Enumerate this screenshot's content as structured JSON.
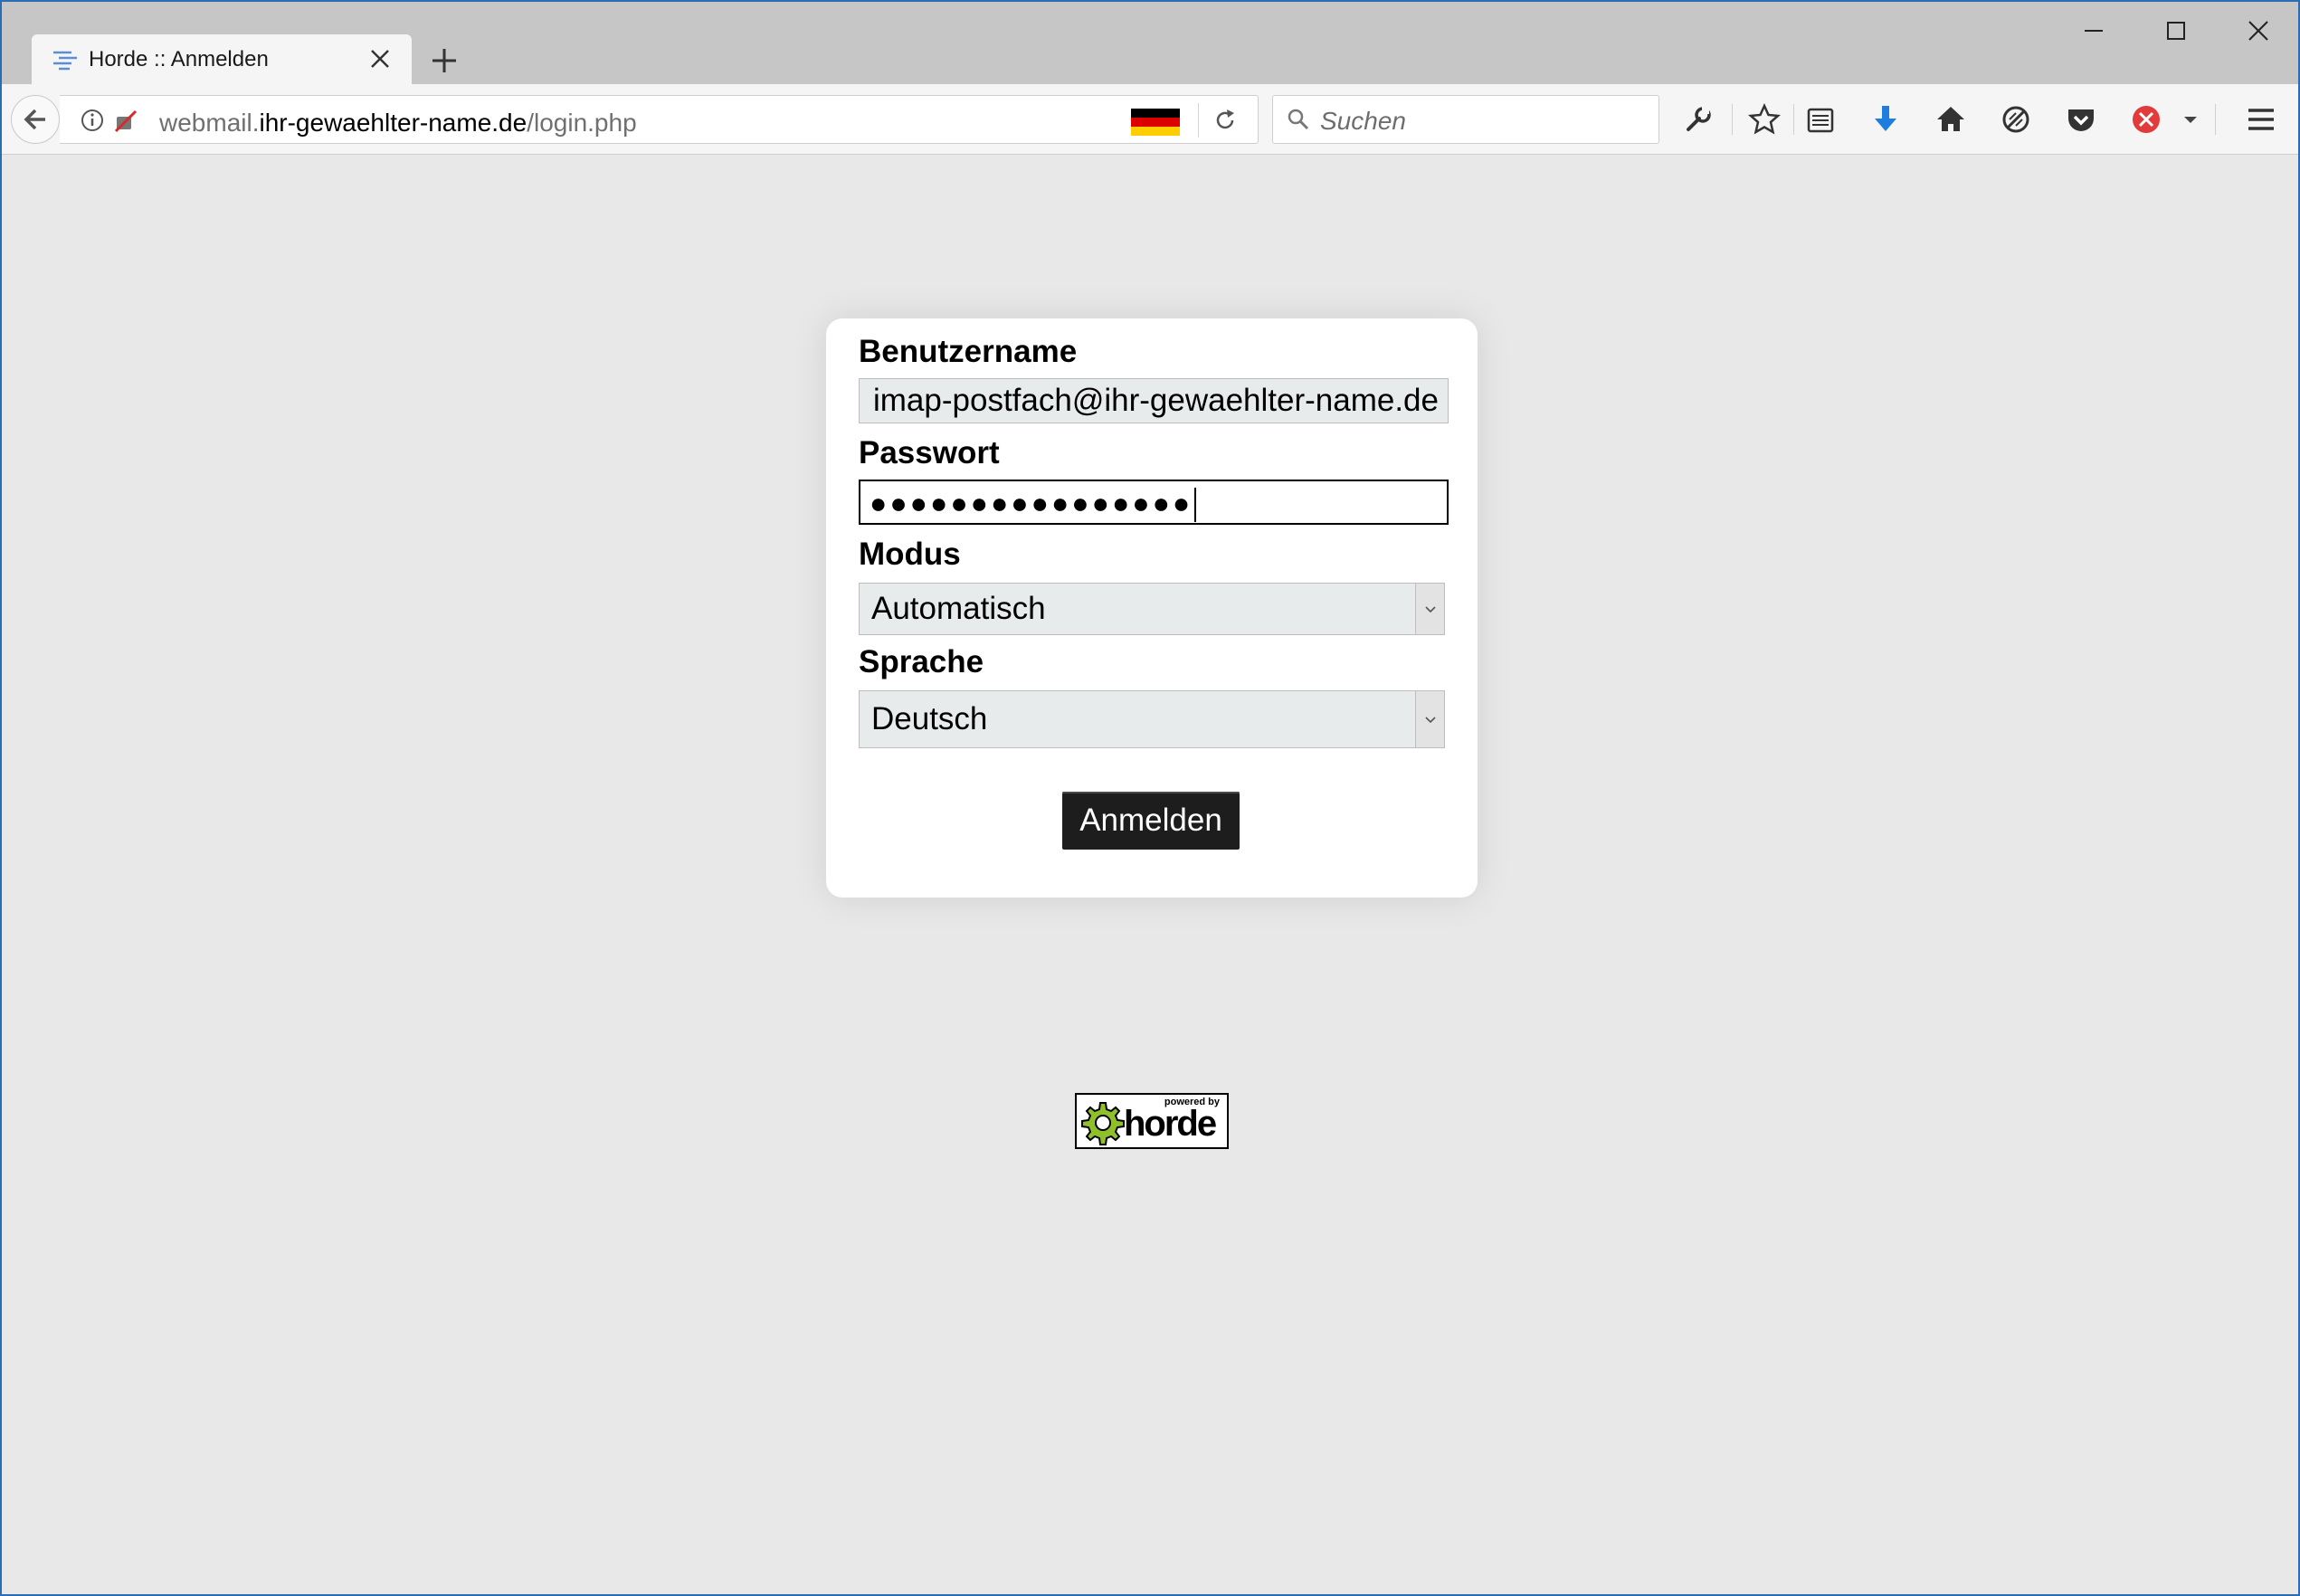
{
  "browser": {
    "tab_title": "Horde :: Anmelden",
    "url_prefix": "webmail.",
    "url_host": "ihr-gewaehlter-name.de",
    "url_path": "/login.php",
    "search_placeholder": "Suchen",
    "icons": [
      "back-icon",
      "info-icon",
      "insecure-connection-icon",
      "german-flag-icon",
      "reload-icon",
      "search-icon",
      "wrench-icon",
      "bookmark-star-icon",
      "reading-list-icon",
      "download-icon",
      "home-icon",
      "sync-icon",
      "pocket-icon",
      "blocked-addon-icon",
      "dropdown-icon",
      "hamburger-menu-icon"
    ]
  },
  "login": {
    "username_label": "Benutzername",
    "username_value": "imap-postfach@ihr-gewaehlter-name.de",
    "password_label": "Passwort",
    "password_masked": "●●●●●●●●●●●●●●●●",
    "mode_label": "Modus",
    "mode_value": "Automatisch",
    "language_label": "Sprache",
    "language_value": "Deutsch",
    "submit_label": "Anmelden"
  },
  "footer": {
    "logo_small_text": "powered by",
    "logo_word": "horde"
  }
}
